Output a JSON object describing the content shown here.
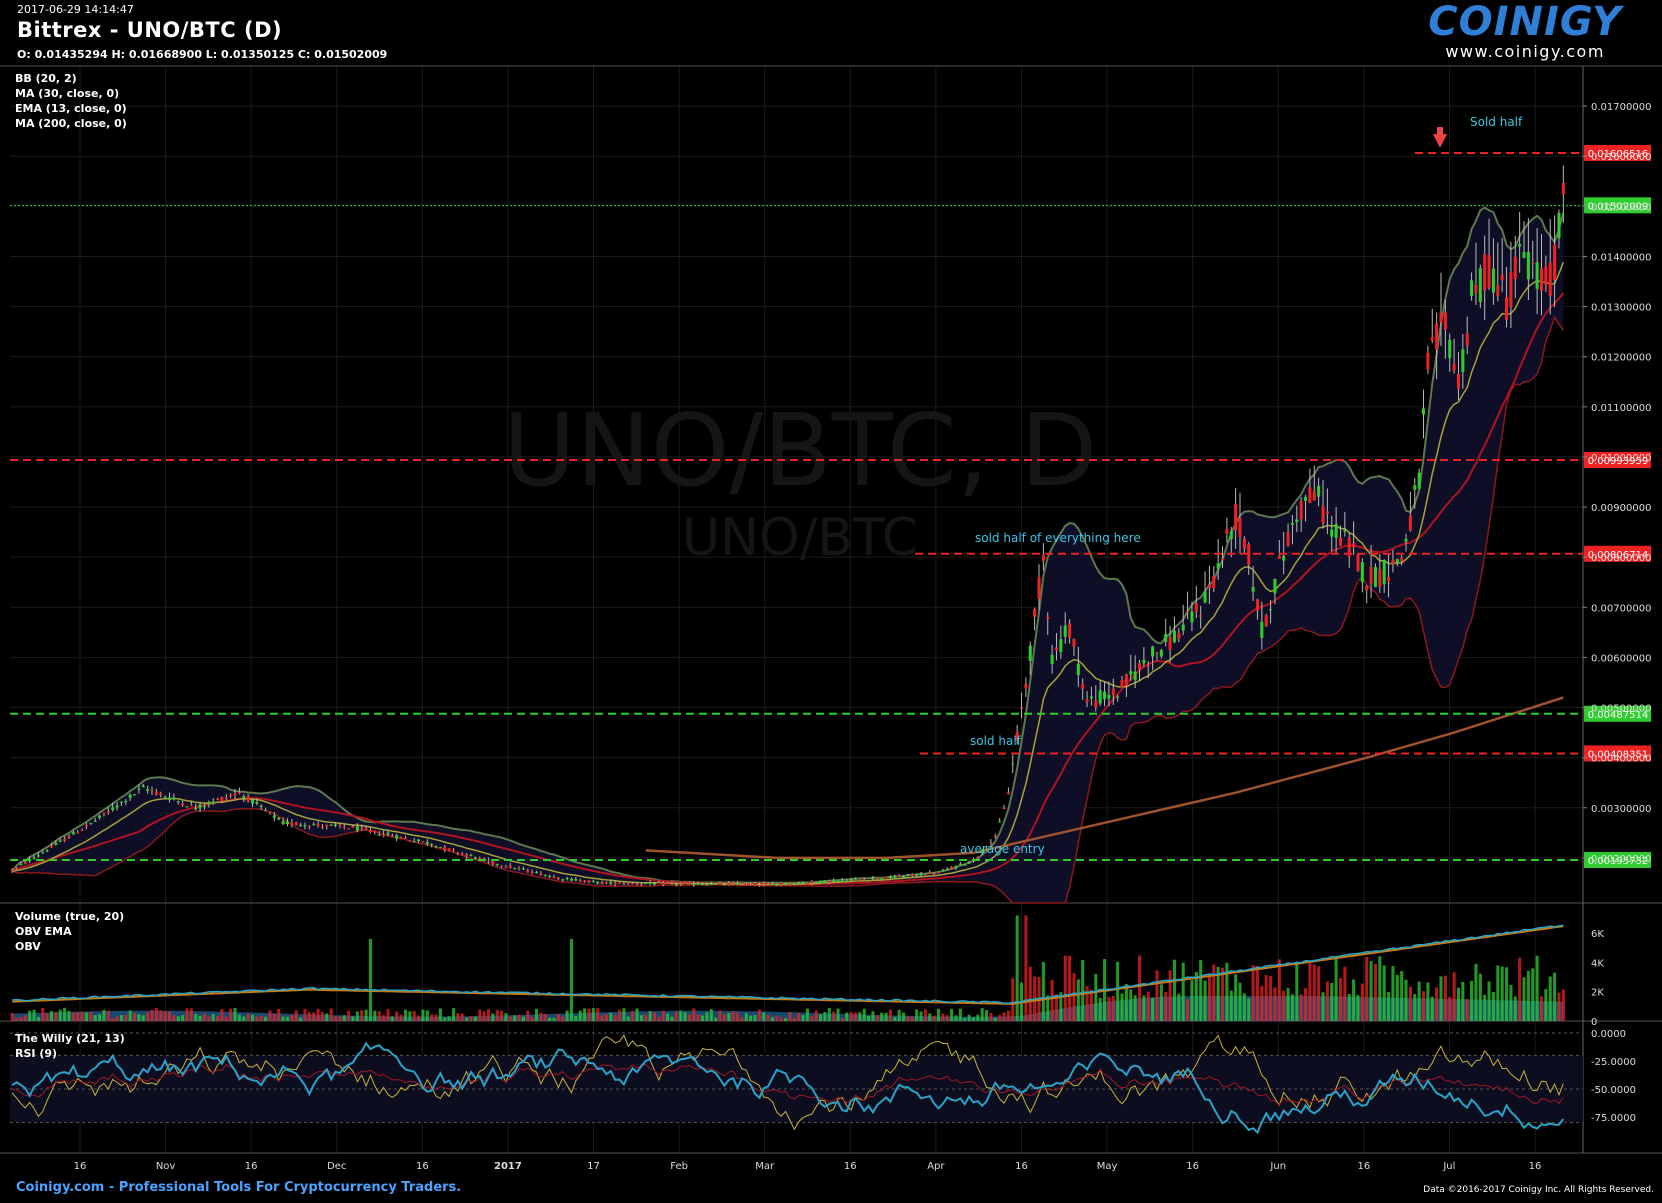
{
  "header": {
    "timestamp": "2017-06-29 14:14:47",
    "title": "Bittrex - UNO/BTC (D)",
    "ohlc": "O: 0.01435294 H: 0.01668900 L: 0.01350125 C: 0.01502009"
  },
  "logo": {
    "brand": "COINIGY",
    "site": "www.coinigy.com"
  },
  "indicators_main": [
    "BB (20, 2)",
    "MA (30, close, 0)",
    "EMA (13, close, 0)",
    "MA (200, close, 0)"
  ],
  "indicators_volume": [
    "Volume (true, 20)",
    "OBV EMA",
    "OBV"
  ],
  "indicators_osc": [
    "The Willy (21, 13)",
    "RSI (9)"
  ],
  "watermark": {
    "big": "UNO/BTC, D",
    "small": "UNO/BTC"
  },
  "footer": {
    "left": "Coinigy.com - Professional Tools For Cryptocurrency Traders.",
    "right": "Data ©2016-2017 Coinigy Inc. All Rights Reserved."
  },
  "colors": {
    "up": "#2ecc2e",
    "down": "#ee2222",
    "bb": "#5d7a4e",
    "ma30": "#b0121f",
    "ema13": "#a7a33a",
    "ma200": "#a0522d",
    "obv": "#26a6c9",
    "obv_ema": "#c87d12",
    "willy": "#2aa3c8",
    "rsi": "#c8b43a",
    "accent": "#2f7fd6"
  },
  "chart_data": {
    "type": "candlestick",
    "y_axis": {
      "min": 0.0011,
      "max": 0.0178,
      "tick_labels": [
        "0.01700000",
        "0.01600000",
        "0.01500000",
        "0.01400000",
        "0.01300000",
        "0.01200000",
        "0.01100000",
        "0.01000000",
        "0.00900000",
        "0.00800000",
        "0.00700000",
        "0.00600000",
        "0.00500000",
        "0.00400000",
        "0.00300000",
        "0.00200000"
      ]
    },
    "x_axis": {
      "tick_labels": [
        "16",
        "Nov",
        "16",
        "Dec",
        "16",
        "2017",
        "17",
        "Feb",
        "Mar",
        "16",
        "Apr",
        "16",
        "May",
        "16",
        "Jun",
        "16",
        "Jul",
        "16"
      ]
    },
    "price_levels": [
      {
        "label": "0.01606516",
        "color": "#ee2222",
        "style": "dashed",
        "value": 0.01606516
      },
      {
        "label": "0.01502009",
        "color": "#2ecc2e",
        "style": "dotted",
        "value": 0.01502009
      },
      {
        "label": "0.00993959",
        "color": "#ee2222",
        "style": "dashed",
        "value": 0.00993959
      },
      {
        "label": "0.00806714",
        "color": "#ee2222",
        "style": "dashed",
        "value": 0.00806714
      },
      {
        "label": "0.00487514",
        "color": "#2ecc2e",
        "style": "dashed",
        "value": 0.00487514
      },
      {
        "label": "0.00408351",
        "color": "#ee2222",
        "style": "dashed",
        "value": 0.00408351
      },
      {
        "label": "0.00195732",
        "color": "#2ecc2e",
        "style": "dashed",
        "value": 0.00195732
      }
    ],
    "annotations": [
      {
        "text": "Sold half",
        "value": 0.0166
      },
      {
        "text": "sold half of everything here",
        "value": 0.0083
      },
      {
        "text": "sold half",
        "value": 0.00425
      },
      {
        "text": "average entry",
        "value": 0.0021
      }
    ],
    "volume_axis": {
      "tick_labels": [
        "6K",
        "4K",
        "2K",
        "0"
      ]
    },
    "osc_axis": {
      "tick_labels": [
        "0.0000",
        "-25.0000",
        "-50.0000",
        "-75.0000"
      ]
    },
    "price_path": [
      [
        0,
        0.00175
      ],
      [
        18,
        0.00268
      ],
      [
        30,
        0.0034
      ],
      [
        42,
        0.003
      ],
      [
        52,
        0.0033
      ],
      [
        62,
        0.0027
      ],
      [
        78,
        0.0026
      ],
      [
        95,
        0.0023
      ],
      [
        110,
        0.0019
      ],
      [
        125,
        0.0016
      ],
      [
        135,
        0.0015
      ],
      [
        150,
        0.00148
      ],
      [
        175,
        0.00147
      ],
      [
        185,
        0.00152
      ],
      [
        200,
        0.0016
      ],
      [
        212,
        0.0017
      ],
      [
        220,
        0.00195
      ],
      [
        225,
        0.0024
      ],
      [
        228,
        0.0033
      ],
      [
        232,
        0.0055
      ],
      [
        236,
        0.008
      ],
      [
        238,
        0.006
      ],
      [
        242,
        0.0066
      ],
      [
        246,
        0.0051
      ],
      [
        253,
        0.0053
      ],
      [
        260,
        0.006
      ],
      [
        266,
        0.0064
      ],
      [
        272,
        0.007
      ],
      [
        276,
        0.0078
      ],
      [
        280,
        0.0088
      ],
      [
        283,
        0.008
      ],
      [
        286,
        0.0065
      ],
      [
        290,
        0.0078
      ],
      [
        294,
        0.0089
      ],
      [
        298,
        0.0093
      ],
      [
        302,
        0.0086
      ],
      [
        306,
        0.0082
      ],
      [
        310,
        0.0076
      ],
      [
        314,
        0.0077
      ],
      [
        318,
        0.008
      ],
      [
        322,
        0.0095
      ],
      [
        324,
        0.0118
      ],
      [
        328,
        0.0127
      ],
      [
        331,
        0.0115
      ],
      [
        334,
        0.0131
      ],
      [
        338,
        0.0138
      ],
      [
        342,
        0.0132
      ],
      [
        346,
        0.0141
      ],
      [
        349,
        0.0135
      ],
      [
        352,
        0.0135
      ],
      [
        355,
        0.015
      ]
    ],
    "ma200_path": [
      [
        145,
        0.00215
      ],
      [
        175,
        0.002
      ],
      [
        200,
        0.002
      ],
      [
        220,
        0.0021
      ],
      [
        250,
        0.0027
      ],
      [
        280,
        0.0033
      ],
      [
        310,
        0.004
      ],
      [
        330,
        0.0045
      ],
      [
        355,
        0.0052
      ]
    ]
  }
}
